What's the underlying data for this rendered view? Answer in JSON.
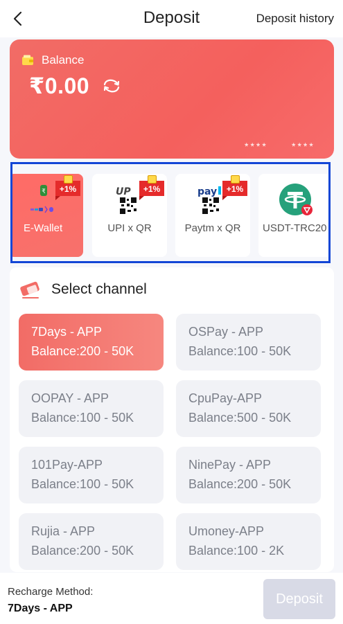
{
  "header": {
    "title": "Deposit",
    "history_link": "Deposit history",
    "back_icon": "chevron-left-icon"
  },
  "balance": {
    "label": "Balance",
    "amount": "₹0.00",
    "masked_1": "****",
    "masked_2": "****",
    "wallet_icon": "wallet-icon",
    "refresh_icon": "refresh-icon"
  },
  "methods": [
    {
      "label": "E-Wallet",
      "bonus": "+1%",
      "icon": "e-wallet-icon",
      "active": true
    },
    {
      "label": "UPI x QR",
      "bonus": "+1%",
      "icon": "upi-qr-icon",
      "active": false
    },
    {
      "label": "Paytm x QR",
      "bonus": "+1%",
      "icon": "paytm-qr-icon",
      "active": false
    },
    {
      "label": "USDT-TRC20",
      "bonus": "",
      "icon": "tether-icon",
      "active": false
    }
  ],
  "channel_section": {
    "title": "Select channel",
    "icon": "eraser-icon"
  },
  "channels": [
    {
      "name": "7Days - APP",
      "range": "Balance:200 - 50K",
      "active": true
    },
    {
      "name": "OSPay - APP",
      "range": "Balance:100 - 50K",
      "active": false
    },
    {
      "name": "OOPAY - APP",
      "range": "Balance:100 - 50K",
      "active": false
    },
    {
      "name": "CpuPay-APP",
      "range": "Balance:500 - 50K",
      "active": false
    },
    {
      "name": "101Pay-APP",
      "range": "Balance:100 - 50K",
      "active": false
    },
    {
      "name": "NinePay - APP",
      "range": "Balance:200 - 50K",
      "active": false
    },
    {
      "name": "Rujia - APP",
      "range": "Balance:200 - 50K",
      "active": false
    },
    {
      "name": "Umoney-APP",
      "range": "Balance:100 - 2K",
      "active": false
    }
  ],
  "footer": {
    "method_label": "Recharge Method:",
    "method_value": "7Days - APP",
    "deposit_button": "Deposit"
  },
  "colors": {
    "accent": "#f4605d",
    "selection_outline": "#1346d6",
    "button_disabled": "#d8dae6"
  }
}
